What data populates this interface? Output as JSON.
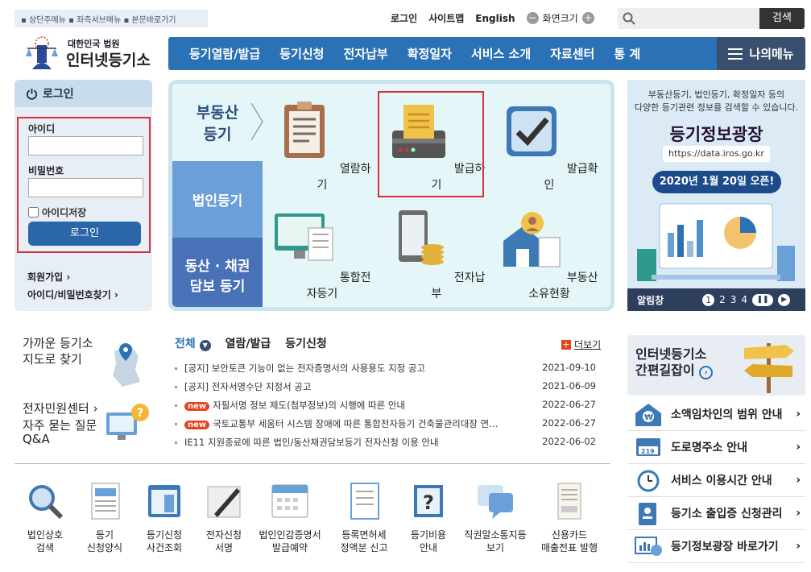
{
  "top": {
    "skip_links": "▪ 상단주메뉴 ▪ 좌측서브메뉴 ▪ 본문바로가기",
    "utils": [
      "로그인",
      "사이트맵",
      "English"
    ],
    "zoom_label": "화면크기",
    "zoom_minus": "−",
    "zoom_plus": "+",
    "search_button": "검색"
  },
  "logo": {
    "line1": "대한민국 법원",
    "line2": "인터넷등기소"
  },
  "nav": {
    "items": [
      "등기열람/발급",
      "등기신청",
      "전자납부",
      "확정일자",
      "서비스 소개",
      "자료센터",
      "통  계"
    ],
    "my_menu": "나의메뉴"
  },
  "login": {
    "title": "로그인",
    "id_label": "아이디",
    "pw_label": "비밀번호",
    "save_id": "아이디저장",
    "button": "로그인",
    "join": "회원가입",
    "find": "아이디/비밀번호찾기"
  },
  "service": {
    "tabs": [
      "부동산\n등기",
      "법인등기",
      "동산 · 채권\n담보 등기"
    ],
    "items": [
      "열람하기",
      "발급하기",
      "발급확인",
      "통합전자등기",
      "전자납부",
      "부동산소유현황"
    ]
  },
  "banner": {
    "line1": "부동산등기, 법인등기, 확정일자 등의",
    "line2": "다양한 등기관련 정보를 검색할 수 있습니다.",
    "big": "등기정보광장",
    "url": "https://data.iros.go.kr",
    "date": "2020년 1월 20일 오픈!",
    "ctrl_label": "알림창",
    "pages": [
      "1",
      "2",
      "3",
      "4"
    ]
  },
  "left_links": {
    "find_office": "가까운 등기소\n지도로 찾기",
    "center": "전자민원센터",
    "faq": "자주 묻는 질문\nQ&A"
  },
  "notices": {
    "tabs": [
      "전체",
      "열람/발급",
      "등기신청"
    ],
    "more": "더보기",
    "new_badge": "new",
    "rows": [
      {
        "title": "[공지] 보안토큰 기능이 없는 전자증명서의 사용용도 지정 공고",
        "date": "2021-09-10",
        "new": false
      },
      {
        "title": "[공지] 전자서명수단 지정서 공고",
        "date": "2021-06-09",
        "new": false
      },
      {
        "title": "자필서명 정보 제도(첨부정보)의 시행에 따른 안내",
        "date": "2022-06-27",
        "new": true
      },
      {
        "title": "국토교통부 세움터 시스템 장애에 따른 통합전자등기 건축물관리대장 연…",
        "date": "2022-06-27",
        "new": true
      },
      {
        "title": "IE11 지원종료에 따른 법인/동산채권담보등기 전자신청 이용 안내",
        "date": "2022-06-02",
        "new": false
      }
    ]
  },
  "quick": [
    "법인상호\n검색",
    "등기\n신청양식",
    "등기신청\n사건조회",
    "전자신청\n서명",
    "법인인감증명서\n발급예약",
    "등록면허세\n정액분 신고",
    "등기비용\n안내",
    "직권말소통지등\n보기",
    "신용카드\n매출전표 발행"
  ],
  "guide": {
    "title1": "인터넷등기소",
    "title2": "간편길잡이"
  },
  "right_links": [
    "소액임차인의 범위 안내",
    "도로명주소 안내",
    "서비스 이용시간 안내",
    "등기소 출입증 신청관리",
    "등기정보광장 바로가기"
  ],
  "colors": {
    "nav": "#2a71b5",
    "accent_red": "#d6303d",
    "new": "#e5431c"
  }
}
